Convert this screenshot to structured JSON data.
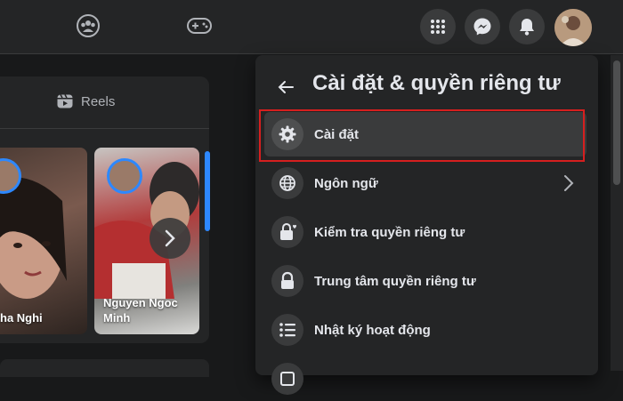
{
  "topbar": {
    "icons": [
      "groups-icon",
      "gaming-icon",
      "menu-grid-icon",
      "messenger-icon",
      "notifications-icon",
      "avatar"
    ]
  },
  "feed": {
    "reels_tab_label": "Reels",
    "stories": [
      {
        "name": "ha Nghi"
      },
      {
        "name": "Nguyen Ngoc Minh"
      }
    ]
  },
  "settings_panel": {
    "title": "Cài đặt & quyền riêng tư",
    "items": [
      {
        "label": "Cài đặt",
        "icon": "gear-icon"
      },
      {
        "label": "Ngôn ngữ",
        "icon": "globe-icon"
      },
      {
        "label": "Kiểm tra quyền riêng tư",
        "icon": "lock-heart-icon"
      },
      {
        "label": "Trung tâm quyền riêng tư",
        "icon": "lock-icon"
      },
      {
        "label": "Nhật ký hoạt động",
        "icon": "list-icon"
      }
    ]
  },
  "colors": {
    "background": "#18191a",
    "surface": "#242526",
    "hover": "#3a3b3c",
    "text": "#e4e6eb",
    "highlight": "#d61f1f",
    "accent": "#2d88ff"
  }
}
